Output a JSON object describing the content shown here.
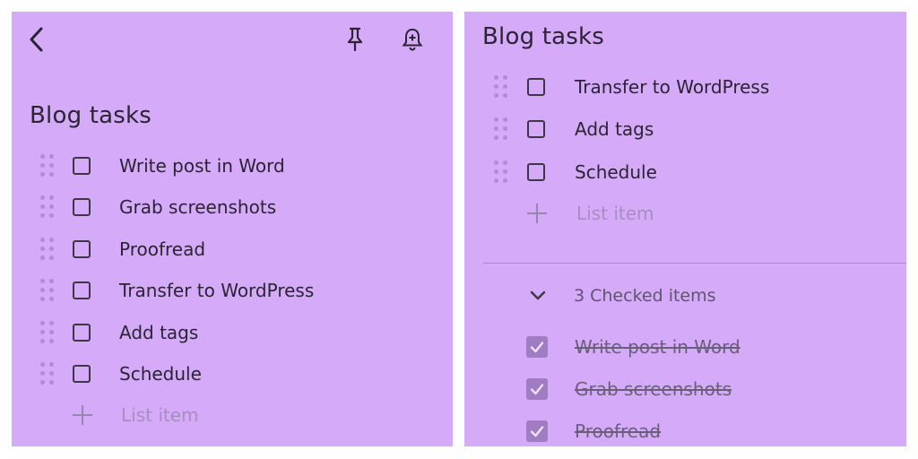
{
  "left": {
    "title": "Blog tasks",
    "items": [
      {
        "label": "Write post in Word"
      },
      {
        "label": "Grab screenshots"
      },
      {
        "label": "Proofread"
      },
      {
        "label": "Transfer to WordPress"
      },
      {
        "label": "Add tags"
      },
      {
        "label": "Schedule"
      }
    ],
    "add_placeholder": "List item"
  },
  "right": {
    "title": "Blog tasks",
    "items": [
      {
        "label": "Transfer to WordPress"
      },
      {
        "label": "Add tags"
      },
      {
        "label": "Schedule"
      }
    ],
    "add_placeholder": "List item",
    "checked_header": "3 Checked items",
    "checked_items": [
      {
        "label": "Write post in Word"
      },
      {
        "label": "Grab screenshots"
      },
      {
        "label": "Proofread"
      }
    ]
  },
  "icons": {
    "back": "chevron-left-icon",
    "pin": "pin-icon",
    "reminder": "bell-plus-icon",
    "drag": "drag-handle-icon",
    "collapse": "chevron-down-icon"
  },
  "colors": {
    "note_background": "#d4aaf9",
    "text": "#2b2433",
    "checked_box": "#a07cc2"
  }
}
